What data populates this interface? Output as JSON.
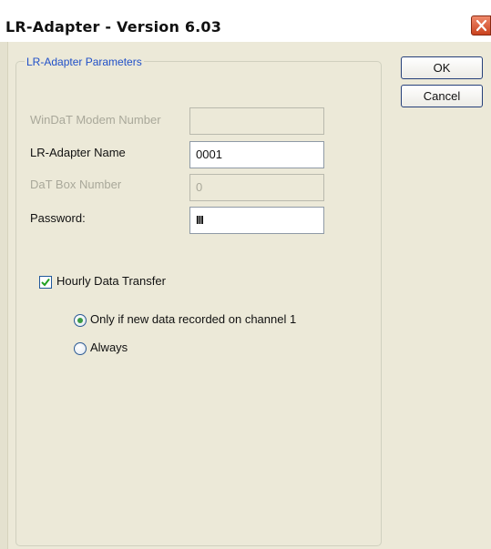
{
  "window": {
    "title": "LR-Adapter - Version 6.03"
  },
  "group": {
    "title": "LR-Adapter Parameters"
  },
  "fields": {
    "modem_number": {
      "label": "WinDaT Modem Number",
      "value": ""
    },
    "adapter_name": {
      "label": "LR-Adapter Name",
      "value": "0001"
    },
    "box_number": {
      "label": "DaT Box Number",
      "value": "0"
    },
    "password": {
      "label": "Password:",
      "value": "III"
    }
  },
  "buttons": {
    "ok": "OK",
    "cancel": "Cancel"
  },
  "hourly_transfer": {
    "label": "Hourly Data Transfer",
    "checked": true,
    "options": [
      {
        "label": "Only if new data recorded on channel 1",
        "selected": true
      },
      {
        "label": "Always",
        "selected": false
      }
    ]
  },
  "colors": {
    "dialog_bg": "#ece9d8",
    "group_title": "#2050c8",
    "close_button": "#d9572f",
    "check_mark": "#21a121",
    "disabled_text": "#a9a89a"
  }
}
